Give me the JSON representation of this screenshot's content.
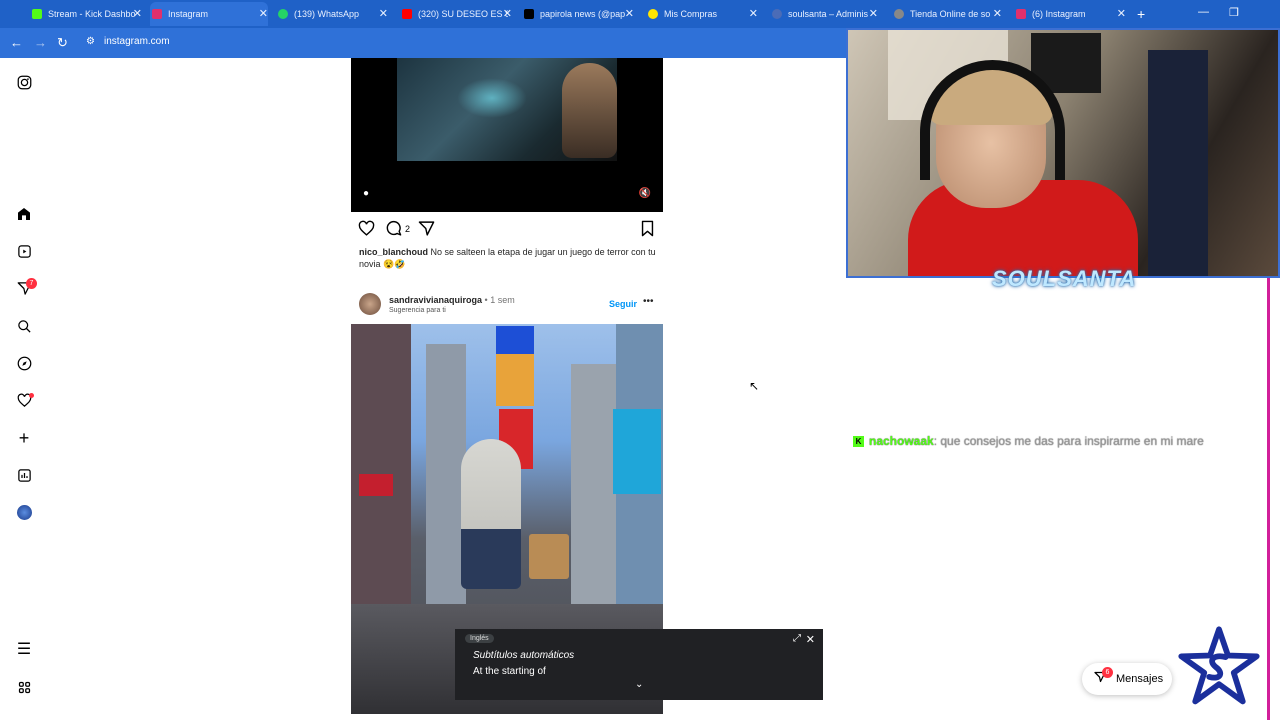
{
  "browser": {
    "tabs": [
      {
        "title": "Stream - Kick Dashbo",
        "icon": "kick-icon",
        "color": "#53fc18"
      },
      {
        "title": "Instagram",
        "icon": "instagram-icon",
        "color": "#e1306c",
        "active": true
      },
      {
        "title": "(139) WhatsApp",
        "icon": "whatsapp-icon",
        "color": "#25d366"
      },
      {
        "title": "(320) SU DESEO ES S",
        "icon": "youtube-icon",
        "color": "#ff0000"
      },
      {
        "title": "papirola news (@pap",
        "icon": "tiktok-icon",
        "color": "#000000"
      },
      {
        "title": "Mis Compras",
        "icon": "cart-icon",
        "color": "#ffe600"
      },
      {
        "title": "soulsanta – Adminis",
        "icon": "admin-icon",
        "color": "#4b6cb7"
      },
      {
        "title": "Tienda Online de so",
        "icon": "store-icon",
        "color": "#888888"
      },
      {
        "title": "(6) Instagram",
        "icon": "instagram-icon",
        "color": "#e1306c"
      }
    ],
    "url": "instagram.com"
  },
  "sidebar": {
    "notifications_badge": "7"
  },
  "post1": {
    "comment_count": "2",
    "caption_user": "nico_blanchoud",
    "caption_text": " No se salteen la etapa de jugar un juego de terror con tu novia 😵🤣"
  },
  "post2": {
    "username": "sandravivianaquiroga",
    "time": " • 1 sem",
    "subtitle": "Sugerencia para ti",
    "follow_label": "Seguir",
    "more_label": "•••"
  },
  "captions_overlay": {
    "language": "Inglés",
    "title": "Subtítulos automáticos",
    "text": "At the starting of"
  },
  "stream": {
    "overlay_logo_text": "SOULSANTA",
    "chat": {
      "platform_badge": "K",
      "user": "nachowaak",
      "message": ": que consejos me das para inspirarme en mi mare"
    }
  },
  "messages": {
    "label": "Mensajes",
    "badge": "6"
  },
  "colors": {
    "tab_bar": "#1f61c7",
    "accent_blue": "#0095f6",
    "kick_green": "#53fc18",
    "notification_red": "#ff3040"
  }
}
